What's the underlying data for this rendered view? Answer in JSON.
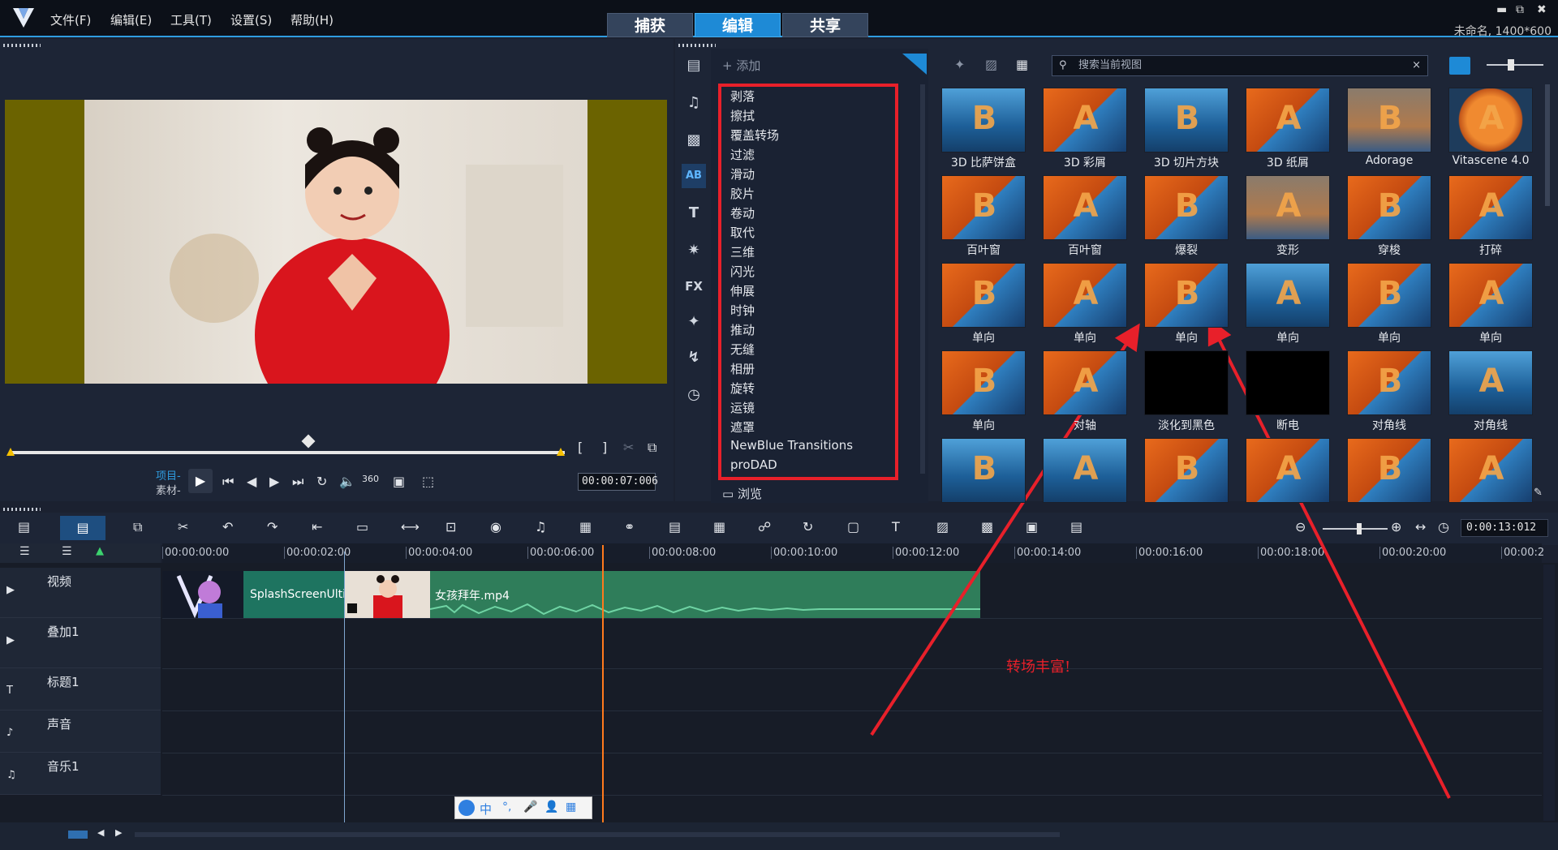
{
  "menubar": {
    "items": [
      "文件(F)",
      "编辑(E)",
      "工具(T)",
      "设置(S)",
      "帮助(H)"
    ]
  },
  "mode_tabs": [
    {
      "label": "捕获",
      "active": false
    },
    {
      "label": "编辑",
      "active": true
    },
    {
      "label": "共享",
      "active": false
    }
  ],
  "project": {
    "name": "未命名, 1400*600"
  },
  "player": {
    "project_label": "项目-",
    "clip_label": "素材-",
    "timecode": "00:00:07:006"
  },
  "library": {
    "add_label": "添加",
    "browse_label": "浏览",
    "search_placeholder": "搜索当前视图"
  },
  "categories": [
    "剥落",
    "擦拭",
    "覆盖转场",
    "过滤",
    "滑动",
    "胶片",
    "卷动",
    "取代",
    "三维",
    "闪光",
    "伸展",
    "时钟",
    "推动",
    "无缝",
    "相册",
    "旋转",
    "运镜",
    "遮罩",
    "NewBlue Transitions",
    "proDAD"
  ],
  "transitions": [
    {
      "label": "3D 比萨饼盒",
      "style": "a"
    },
    {
      "label": "3D 彩屑",
      "style": "b"
    },
    {
      "label": "3D 切片方块",
      "style": "a"
    },
    {
      "label": "3D 纸屑",
      "style": "b"
    },
    {
      "label": "Adorage",
      "style": "c"
    },
    {
      "label": "Vitascene 4.0",
      "style": "d"
    },
    {
      "label": "百叶窗",
      "style": "b"
    },
    {
      "label": "百叶窗",
      "style": "b"
    },
    {
      "label": "爆裂",
      "style": "b"
    },
    {
      "label": "变形",
      "style": "c"
    },
    {
      "label": "穿梭",
      "style": "b"
    },
    {
      "label": "打碎",
      "style": "b"
    },
    {
      "label": "单向",
      "style": "b"
    },
    {
      "label": "单向",
      "style": "b"
    },
    {
      "label": "单向",
      "style": "b"
    },
    {
      "label": "单向",
      "style": "a"
    },
    {
      "label": "单向",
      "style": "b"
    },
    {
      "label": "单向",
      "style": "b"
    },
    {
      "label": "单向",
      "style": "b"
    },
    {
      "label": "对轴",
      "style": "b"
    },
    {
      "label": "淡化到黑色",
      "style": "e"
    },
    {
      "label": "断电",
      "style": "e"
    },
    {
      "label": "对角线",
      "style": "b"
    },
    {
      "label": "对角线",
      "style": "a"
    },
    {
      "label": "",
      "style": "a"
    },
    {
      "label": "",
      "style": "a"
    },
    {
      "label": "",
      "style": "b"
    },
    {
      "label": "",
      "style": "b"
    },
    {
      "label": "",
      "style": "b"
    },
    {
      "label": "",
      "style": "b"
    }
  ],
  "timeline": {
    "ruler": [
      "00:00:00:00",
      "00:00:02:00",
      "00:00:04:00",
      "00:00:06:00",
      "00:00:08:00",
      "00:00:10:00",
      "00:00:12:00",
      "00:00:14:00",
      "00:00:16:00",
      "00:00:18:00",
      "00:00:20:00",
      "00:00:2"
    ],
    "duration": "0:00:13:012",
    "tracks": [
      "视频",
      "叠加1",
      "标题1",
      "声音",
      "音乐1"
    ],
    "clips": {
      "splash": "SplashScreenUltim",
      "main": "女孩拜年.mp4"
    }
  },
  "annotation": {
    "text": "转场丰富!"
  },
  "ime": {
    "labels": [
      "中",
      "°,",
      "🎤",
      "👤",
      "▦"
    ]
  },
  "colors": {
    "accent": "#1e8ad6",
    "annotation_red": "#e8202a",
    "clip_green": "#2f7d5a",
    "playhead": "#ff7a1c"
  }
}
